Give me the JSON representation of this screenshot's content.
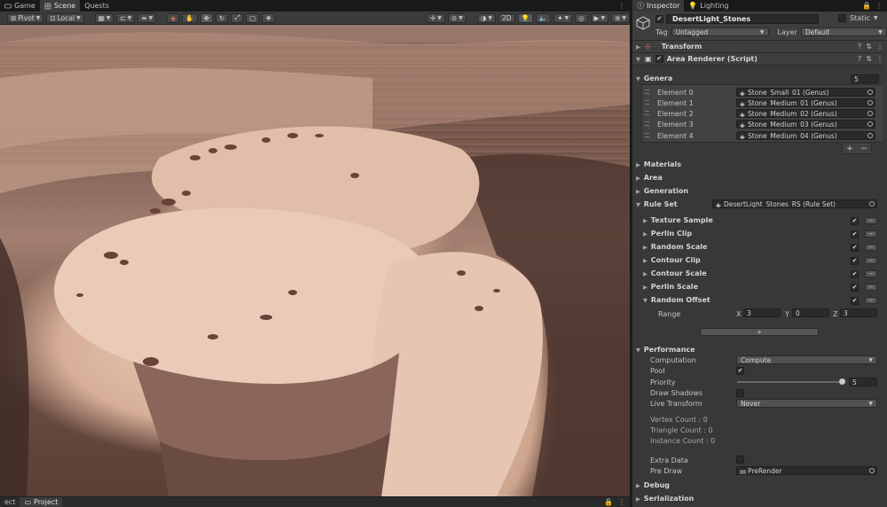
{
  "scene_tabs": [
    {
      "label": "Game",
      "active": false
    },
    {
      "label": "Scene",
      "active": true
    },
    {
      "label": "Quests",
      "active": false
    }
  ],
  "toolbar": {
    "pivot": "Pivot",
    "space": "Local",
    "mode_2d": "2D"
  },
  "bottom_tabs": [
    {
      "label": "ect"
    },
    {
      "label": "Project"
    }
  ],
  "inspector": {
    "tabs": [
      {
        "label": "Inspector",
        "active": true
      },
      {
        "label": "Lighting",
        "active": false
      }
    ],
    "object": {
      "name": "DesertLight_Stones",
      "active": true,
      "static_label": "Static",
      "tag_label": "Tag",
      "tag_value": "Untagged",
      "layer_label": "Layer",
      "layer_value": "Default"
    },
    "components": [
      {
        "label": "Transform"
      },
      {
        "label": "Area Renderer (Script)"
      }
    ],
    "genera": {
      "label": "Genera",
      "count": "5",
      "elements": [
        {
          "label": "Element 0",
          "value": "Stone_Small_01 (Genus)"
        },
        {
          "label": "Element 1",
          "value": "Stone_Medium_01 (Genus)"
        },
        {
          "label": "Element 2",
          "value": "Stone_Medium_02 (Genus)"
        },
        {
          "label": "Element 3",
          "value": "Stone_Medium_03 (Genus)"
        },
        {
          "label": "Element 4",
          "value": "Stone_Medium_04 (Genus)"
        }
      ],
      "add": "+",
      "remove": "−"
    },
    "folds": [
      {
        "label": "Materials"
      },
      {
        "label": "Area"
      },
      {
        "label": "Generation"
      }
    ],
    "rule_set": {
      "label": "Rule Set",
      "value": "DesertLight_Stones_RS (Rule Set)",
      "rules": [
        {
          "label": "Texture Sample",
          "enabled": true
        },
        {
          "label": "Perlin Clip",
          "enabled": true
        },
        {
          "label": "Random Scale",
          "enabled": true
        },
        {
          "label": "Contour Clip",
          "enabled": true
        },
        {
          "label": "Contour Scale",
          "enabled": true
        },
        {
          "label": "Perlin Scale",
          "enabled": true
        },
        {
          "label": "Random Offset",
          "enabled": true
        }
      ],
      "range_label": "Range",
      "range": {
        "x_label": "X",
        "x": "3",
        "y_label": "Y",
        "y": "0",
        "z_label": "Z",
        "z": "3"
      },
      "add_rule": "+"
    },
    "performance": {
      "label": "Performance",
      "computation_label": "Computation",
      "computation_value": "Compute",
      "pool_label": "Pool",
      "pool": true,
      "priority_label": "Priority",
      "priority_value": "5",
      "priority_fraction": 1.0,
      "draw_shadows_label": "Draw Shadows",
      "draw_shadows": false,
      "live_transform_label": "Live Transform",
      "live_transform_value": "Never",
      "vertex_count": "Vertex Count : 0",
      "triangle_count": "Triangle Count : 0",
      "instance_count": "Instance Count : 0",
      "extra_data_label": "Extra Data",
      "pre_draw_label": "Pre Draw",
      "pre_draw_value": "PreRender"
    },
    "bottom_folds": [
      {
        "label": "Debug"
      },
      {
        "label": "Serialization"
      }
    ]
  },
  "colors": {
    "accent": "#e07b5a",
    "panel": "#383838",
    "field": "#2a2a2a"
  }
}
